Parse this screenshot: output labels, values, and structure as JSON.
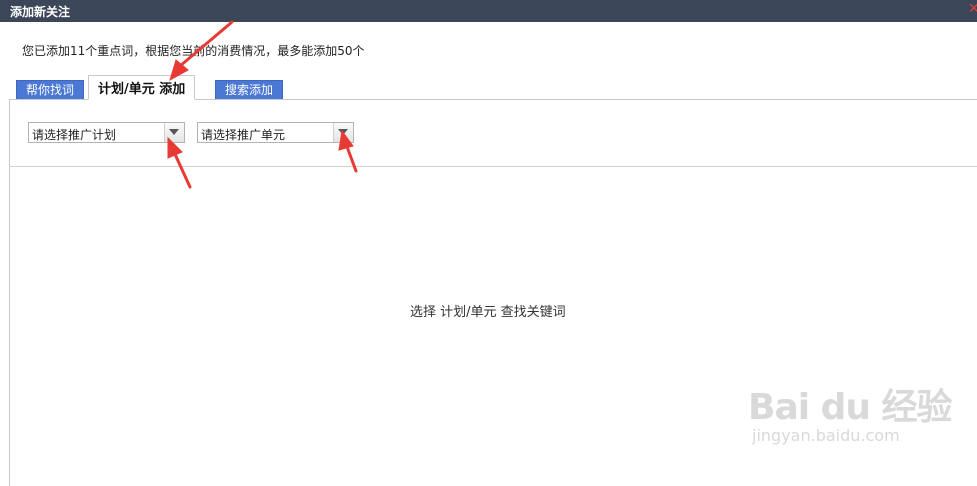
{
  "dialog": {
    "title": "添加新关注",
    "close_icon": "close-icon",
    "info_text": "您已添加11个重点词，根据您当前的消费情况，最多能添加50个"
  },
  "tabs": [
    {
      "label": "帮你找词",
      "active": false
    },
    {
      "label": "计划/单元 添加",
      "active": true
    },
    {
      "label": "搜索添加",
      "active": false
    }
  ],
  "filters": {
    "plan_select": "请选择推广计划",
    "unit_select": "请选择推广单元"
  },
  "content": {
    "placeholder": "选择 计划/单元 查找关键词"
  },
  "watermark": {
    "logo": "Bai du 经验",
    "url": "jingyan.baidu.com"
  },
  "colors": {
    "titlebar": "#3c4659",
    "tab_blue": "#4a78d4",
    "annotation_red": "#e83a34"
  }
}
